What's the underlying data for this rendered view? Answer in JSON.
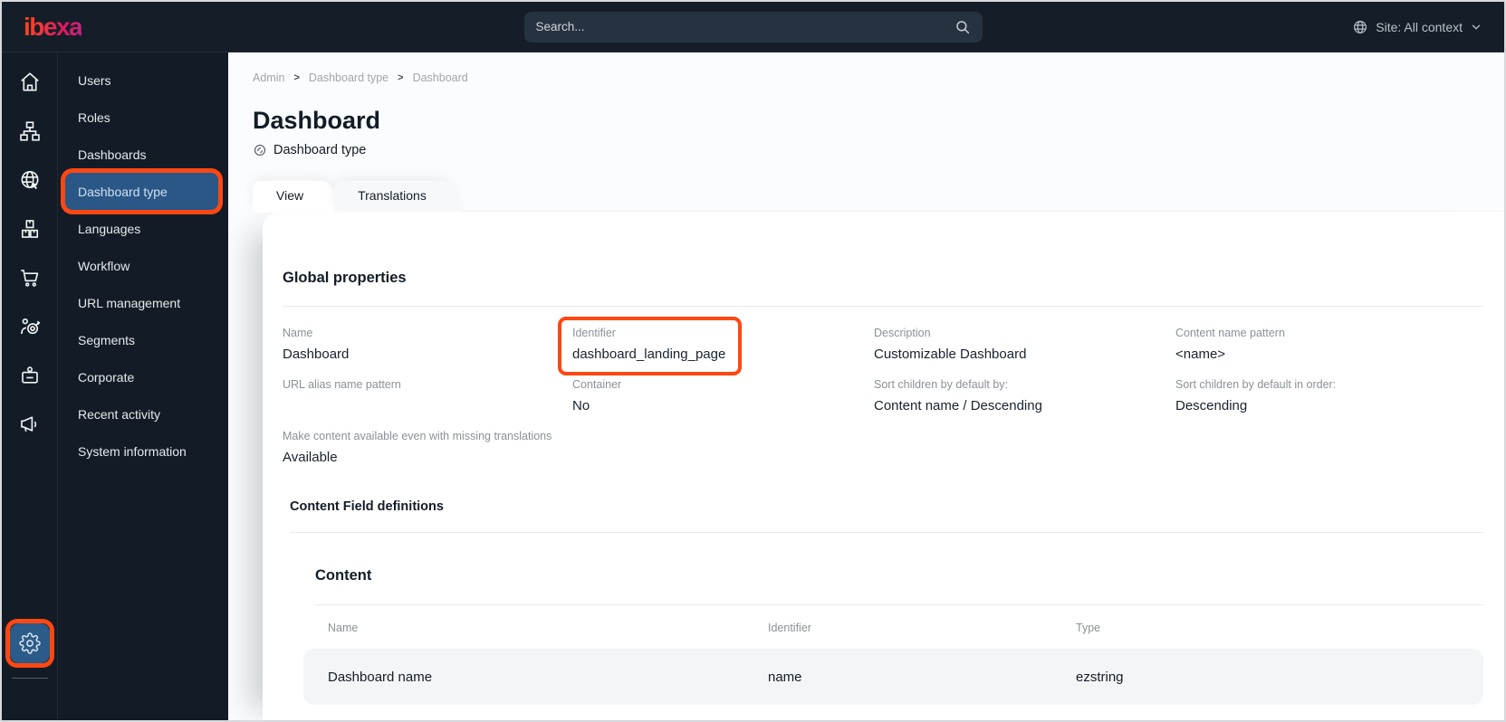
{
  "topbar": {
    "logo_text": "ibexa",
    "search_placeholder": "Search...",
    "site_selector_label": "Site: All context"
  },
  "icon_rail": {
    "icons": [
      "home-icon",
      "sitemap-icon",
      "globe-cursor-icon",
      "boxes-icon",
      "cart-icon",
      "target-person-icon",
      "badge-icon",
      "megaphone-icon",
      "gear-icon"
    ],
    "active_icon": "gear-icon"
  },
  "sidebar": {
    "items": [
      "Users",
      "Roles",
      "Dashboards",
      "Dashboard type",
      "Languages",
      "Workflow",
      "URL management",
      "Segments",
      "Corporate",
      "Recent activity",
      "System information"
    ],
    "selected_item": "Dashboard type"
  },
  "breadcrumb": [
    "Admin",
    "Dashboard type",
    "Dashboard"
  ],
  "page": {
    "title": "Dashboard",
    "subtitle": "Dashboard type"
  },
  "tabs": [
    {
      "label": "View",
      "active": true
    },
    {
      "label": "Translations",
      "active": false
    }
  ],
  "global_properties": {
    "heading": "Global properties",
    "fields": [
      {
        "label": "Name",
        "value": "Dashboard"
      },
      {
        "label": "Identifier",
        "value": "dashboard_landing_page",
        "highlighted": true
      },
      {
        "label": "Description",
        "value": "Customizable Dashboard"
      },
      {
        "label": "Content name pattern",
        "value": "<name>"
      },
      {
        "label": "URL alias name pattern",
        "value": ""
      },
      {
        "label": "Container",
        "value": "No"
      },
      {
        "label": "Sort children by default by:",
        "value": "Content name / Descending"
      },
      {
        "label": "Sort children by default in order:",
        "value": "Descending"
      },
      {
        "label": "Make content available even with missing translations",
        "value": "Available"
      }
    ]
  },
  "content_field_definitions": {
    "heading": "Content Field definitions",
    "group_heading": "Content",
    "table": {
      "headers": [
        "Name",
        "Identifier",
        "Type"
      ],
      "rows": [
        {
          "name": "Dashboard name",
          "identifier": "name",
          "type": "ezstring"
        }
      ]
    }
  },
  "colors": {
    "annotation_orange": "#ff4713",
    "selected_blue": "#2a5786",
    "topbar_dark": "#151e28",
    "sidebar_dark": "#131c26"
  }
}
